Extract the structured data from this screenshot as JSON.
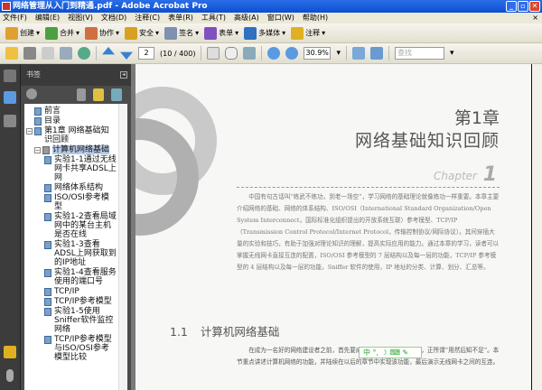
{
  "window": {
    "title": "网络管理从入门到精通.pdf - Adobe Acrobat Pro",
    "minimize": "_",
    "maximize": "▫",
    "close": "✕"
  },
  "menu": {
    "items": [
      "文件(F)",
      "编辑(E)",
      "视图(V)",
      "文档(D)",
      "注释(C)",
      "表单(R)",
      "工具(T)",
      "高级(A)",
      "窗口(W)",
      "帮助(H)"
    ],
    "close": "×"
  },
  "toolbar1": {
    "items": [
      {
        "label": "创建",
        "color": "#e0a030"
      },
      {
        "label": "合并",
        "color": "#4aa040"
      },
      {
        "label": "协作",
        "color": "#d07040"
      },
      {
        "label": "安全",
        "color": "#d8a020"
      },
      {
        "label": "签名",
        "color": "#8090b0"
      },
      {
        "label": "表单",
        "color": "#8050c0"
      },
      {
        "label": "多媒体",
        "color": "#3070c0"
      },
      {
        "label": "注释",
        "color": "#e0b020"
      }
    ]
  },
  "toolbar2": {
    "page_current": "2",
    "page_info": "(10 / 400)",
    "zoom": "30.9%",
    "find_placeholder": "查找"
  },
  "bookmarks": {
    "title": "书签",
    "items": [
      {
        "label": "前言",
        "level": 0
      },
      {
        "label": "目录",
        "level": 0
      },
      {
        "label": "第1章  网络基础知识回顾",
        "level": 0,
        "toggle": "⊟"
      },
      {
        "label": "计算机网络基础",
        "level": 1,
        "toggle": "⊟",
        "selected": true
      },
      {
        "label": "实验1-1通过无线网卡共享ADSL上网",
        "level": 2
      },
      {
        "label": "网络体系结构",
        "level": 2
      },
      {
        "label": "ISO/OSI参考模型",
        "level": 2
      },
      {
        "label": "实验1-2查看局域网中的某台主机是否在线",
        "level": 2
      },
      {
        "label": "实验1-3查看ADSL上网获取到的IP地址",
        "level": 2
      },
      {
        "label": "实验1-4查看服务使用的端口号",
        "level": 2
      },
      {
        "label": "TCP/IP",
        "level": 2
      },
      {
        "label": "TCP/IP参考模型",
        "level": 2
      },
      {
        "label": "实验1-5使用Sniffer软件监控网络",
        "level": 2
      },
      {
        "label": "TCP/IP参考模型与ISO/OSI参考模型比较",
        "level": 2
      }
    ]
  },
  "page": {
    "chapter_num": "第1章",
    "chapter_title": "网络基础知识回顾",
    "chapter_en": "Chapter",
    "chapter_digit": "1",
    "intro": "中国有句古话叫“练武不练功，到老一场空”，学习网络的基础理论就像练功一样重要。本章主要介绍网络的基础、网络的体系结构、ISO/OSI（International Standard Organization/Open System Interconnect，国际标准化组织提出的开放系统互联）参考模型、TCP/IP（Transmission Control Protocol/Internet Protocol，传输控制协议/网际协议）。其间穿插大量的实验和技巧，有助于加强对理论知识的理解，提高实际应用的能力。通过本章的学习，读者可以掌握无线网卡直接互连的配置，ISO/OSI 参考模型的 7 层结构以及每一层的功能，TCP/IP 参考模型的 4 层结构以及每一层的功能，Sniffer 软件的使用，IP 地址的分类、计算、划分、汇总等。",
    "section_num": "1.1",
    "section_title": "计算机网络基础",
    "section_text": "在成为一名好的网络建设者之前，首先要成为一名好的网络使用者，正所谓“用然后知不足”。本节重点讲述计算机网络的功能，并陆续在以后的章节中实现该功能，最后演示无线网卡之间的互连。"
  },
  "ime": {
    "label": "中 °, ☽ ⌨ ✎"
  }
}
